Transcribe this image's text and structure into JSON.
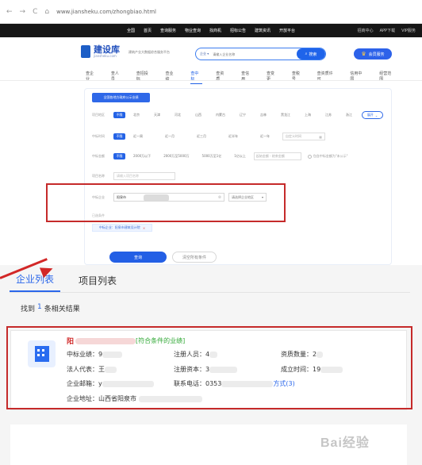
{
  "browser": {
    "back": "←",
    "forward": "→",
    "reload": "C",
    "secure": "⌂",
    "url": "www.jiansheku.com/zhongbiao.html"
  },
  "site_nav": {
    "items": [
      "全国",
      "首页",
      "查询服务",
      "物业查询",
      "找商机",
      "招标公告",
      "建筑资讯",
      "开放平台"
    ],
    "right": [
      "招商中心",
      "APP下载",
      "VIP服务"
    ]
  },
  "brand": {
    "title": "建设库",
    "domain": "jiansheku.com",
    "slogan": "建筑产业大数据综合服务平台"
  },
  "search": {
    "scope": "企业 ▾",
    "placeholder": "请输入企业名称",
    "button": "搜索"
  },
  "member": {
    "label": "会员服务"
  },
  "category_tabs": [
    "查企业",
    "查人员",
    "查招投标",
    "查业绩",
    "查中标",
    "查资质",
    "查信用",
    "查变更",
    "查税号",
    "查资质许可",
    "信用中国",
    "经营范围"
  ],
  "filter": {
    "nationwide_label": "全国各地方政府公示业绩",
    "region": {
      "label": "项目地区",
      "unlimited": "不限",
      "options": [
        "北京",
        "天津",
        "河北",
        "山西",
        "内蒙古",
        "辽宁",
        "吉林",
        "黑龙江",
        "上海",
        "江苏",
        "浙江"
      ],
      "expand": "展开"
    },
    "time": {
      "label": "中标时间",
      "unlimited": "不限",
      "options": [
        "近一周",
        "近一月",
        "近三月",
        "近半年",
        "近一年"
      ],
      "date_placeholder": "自定义时间"
    },
    "amount": {
      "label": "中标金额",
      "unlimited": "不限",
      "options": [
        "2000万以下",
        "2000万至5000万",
        "5000万至1亿",
        "1亿以上"
      ],
      "range_placeholder": "起始金额 - 结束金额",
      "include_option": "包含中标金额为\"未公示\""
    },
    "project_name": {
      "label": "项目名称",
      "placeholder": "请输入项目名称"
    },
    "company": {
      "label": "中标企业",
      "value": "阳泉市",
      "region_select": "请选择企业地区"
    },
    "selected": {
      "label": "已选条件",
      "chip": "中标企业：阳泉市建筑设计院"
    },
    "query_button": "查询",
    "clear_button": "清空所有条件"
  },
  "result_tabs": [
    {
      "label": "企业列表",
      "active": true
    },
    {
      "label": "项目列表",
      "active": false
    }
  ],
  "result_summary": {
    "prefix": "找到",
    "count": "1",
    "suffix": "条相关结果"
  },
  "result": {
    "company_prefix": "阳",
    "match_tag": "[符合条件的业绩]",
    "bid_label": "中标业绩：",
    "bid_value": "9",
    "registered_staff_label": "注册人员：",
    "registered_staff_value": "4",
    "qualification_label": "资质数量：",
    "qualification_value": "2",
    "legal_rep_label": "法人代表：",
    "legal_rep_value": "王",
    "registered_capital_label": "注册资本：",
    "registered_capital_value": "3",
    "established_label": "成立时间：",
    "established_value": "19",
    "email_label": "企业邮箱：",
    "email_value": "y",
    "phone_label": "联系电话：",
    "phone_value": "0353",
    "contact_link": "方式(3)",
    "address_label": "企业地址：",
    "address_value": "山西省阳泉市"
  },
  "watermark": "Bai经验",
  "colors": {
    "brand": "#2150bd",
    "accent": "#235fe5",
    "highlight_frame": "#c52a2a",
    "match": "#31a836"
  }
}
